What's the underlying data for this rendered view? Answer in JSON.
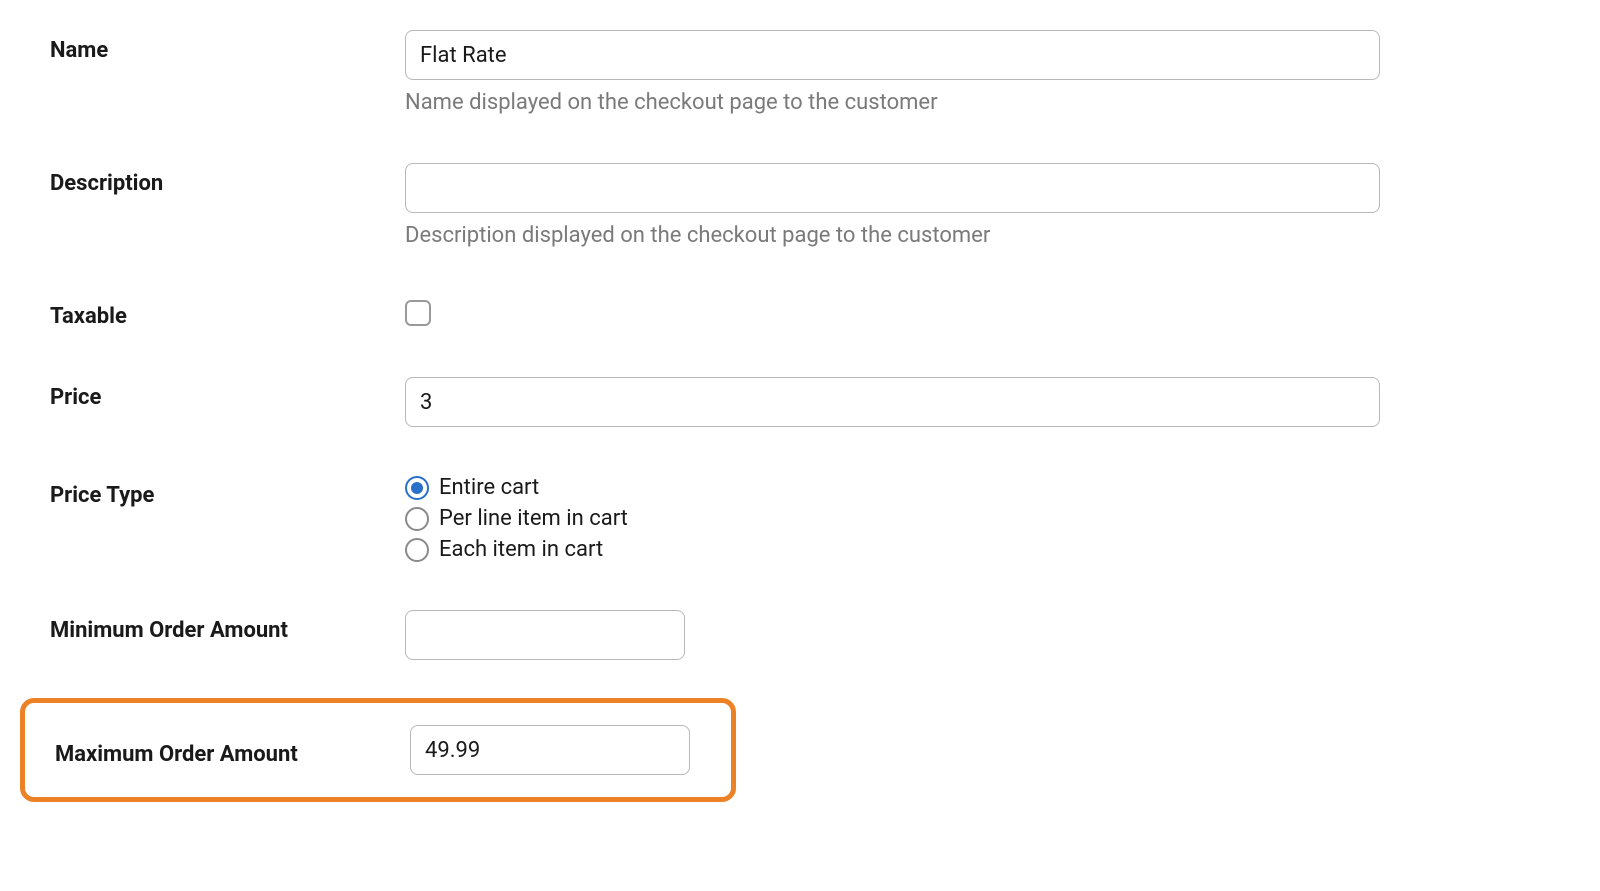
{
  "form": {
    "name": {
      "label": "Name",
      "value": "Flat Rate",
      "helper": "Name displayed on the checkout page to the customer"
    },
    "description": {
      "label": "Description",
      "value": "",
      "helper": "Description displayed on the checkout page to the customer"
    },
    "taxable": {
      "label": "Taxable",
      "checked": false
    },
    "price": {
      "label": "Price",
      "value": "3"
    },
    "price_type": {
      "label": "Price Type",
      "options": [
        {
          "label": "Entire cart",
          "selected": true
        },
        {
          "label": "Per line item in cart",
          "selected": false
        },
        {
          "label": "Each item in cart",
          "selected": false
        }
      ]
    },
    "min_order": {
      "label": "Minimum Order Amount",
      "value": ""
    },
    "max_order": {
      "label": "Maximum Order Amount",
      "value": "49.99"
    }
  }
}
